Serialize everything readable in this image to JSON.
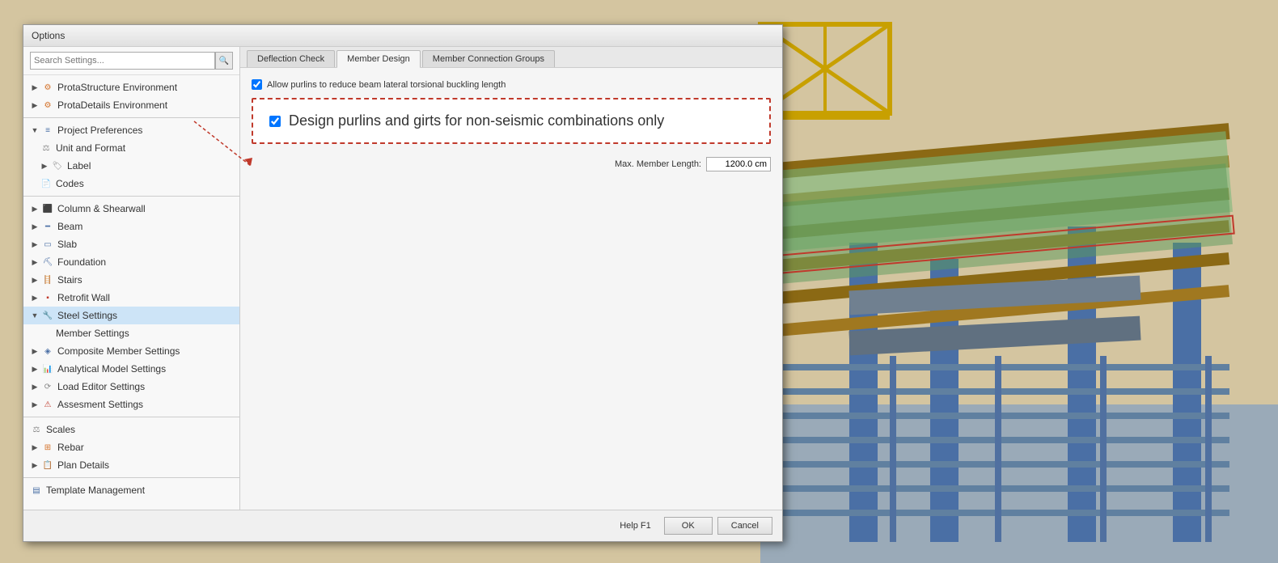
{
  "dialog": {
    "title": "Options",
    "search_placeholder": "Search Settings..."
  },
  "sidebar": {
    "items": [
      {
        "id": "prota-structure",
        "label": "ProtaStructure Environment",
        "level": 0,
        "icon": "orange-gear",
        "expanded": false,
        "selected": false
      },
      {
        "id": "prota-details",
        "label": "ProtaDetails Environment",
        "level": 0,
        "icon": "orange-gear",
        "expanded": false,
        "selected": false
      },
      {
        "id": "project-prefs",
        "label": "Project Preferences",
        "level": 0,
        "icon": "blue-list",
        "expanded": true,
        "selected": false
      },
      {
        "id": "unit-format",
        "label": "Unit and Format",
        "level": 1,
        "icon": "scales",
        "expanded": false,
        "selected": false
      },
      {
        "id": "label",
        "label": "Label",
        "level": 1,
        "icon": "tag",
        "expanded": false,
        "selected": false
      },
      {
        "id": "codes",
        "label": "Codes",
        "level": 1,
        "icon": "doc",
        "expanded": false,
        "selected": false
      },
      {
        "id": "column-shearwall",
        "label": "Column & Shearwall",
        "level": 0,
        "icon": "column",
        "expanded": false,
        "selected": false
      },
      {
        "id": "beam",
        "label": "Beam",
        "level": 0,
        "icon": "beam",
        "expanded": false,
        "selected": false
      },
      {
        "id": "slab",
        "label": "Slab",
        "level": 0,
        "icon": "slab",
        "expanded": false,
        "selected": false
      },
      {
        "id": "foundation",
        "label": "Foundation",
        "level": 0,
        "icon": "foundation",
        "expanded": false,
        "selected": false
      },
      {
        "id": "stairs",
        "label": "Stairs",
        "level": 0,
        "icon": "stairs",
        "expanded": false,
        "selected": false
      },
      {
        "id": "retrofit-wall",
        "label": "Retrofit Wall",
        "level": 0,
        "icon": "wall",
        "expanded": false,
        "selected": false
      },
      {
        "id": "steel-settings",
        "label": "Steel Settings",
        "level": 0,
        "icon": "steel",
        "expanded": true,
        "selected": true
      },
      {
        "id": "member-settings",
        "label": "Member Settings",
        "level": 1,
        "icon": "none",
        "expanded": false,
        "selected": false
      },
      {
        "id": "composite-member",
        "label": "Composite Member Settings",
        "level": 0,
        "icon": "composite",
        "expanded": false,
        "selected": false
      },
      {
        "id": "analytical-model",
        "label": "Analytical Model Settings",
        "level": 0,
        "icon": "analytical",
        "expanded": false,
        "selected": false
      },
      {
        "id": "load-editor",
        "label": "Load Editor Settings",
        "level": 0,
        "icon": "load",
        "expanded": false,
        "selected": false
      },
      {
        "id": "assessment",
        "label": "Assesment Settings",
        "level": 0,
        "icon": "assessment",
        "expanded": false,
        "selected": false
      },
      {
        "id": "scales",
        "label": "Scales",
        "level": 0,
        "icon": "scales2",
        "expanded": false,
        "selected": false
      },
      {
        "id": "rebar",
        "label": "Rebar",
        "level": 0,
        "icon": "rebar",
        "expanded": false,
        "selected": false
      },
      {
        "id": "plan-details",
        "label": "Plan Details",
        "level": 0,
        "icon": "plan",
        "expanded": false,
        "selected": false
      },
      {
        "id": "template-mgmt",
        "label": "Template Management",
        "level": 0,
        "icon": "template",
        "expanded": false,
        "selected": false
      }
    ]
  },
  "tabs": [
    {
      "id": "deflection-check",
      "label": "Deflection Check",
      "active": false
    },
    {
      "id": "member-design",
      "label": "Member Design",
      "active": true
    },
    {
      "id": "member-connection",
      "label": "Member Connection Groups",
      "active": false
    }
  ],
  "content": {
    "checkbox1_label": "Allow purlins to reduce beam lateral torsional buckling length",
    "checkbox1_checked": true,
    "highlight_checkbox_label": "Design purlins and girts for non-seismic combinations only",
    "highlight_checked": true,
    "max_member_length_label": "Max. Member Length:",
    "max_member_length_value": "1200.0 cm"
  },
  "footer": {
    "help_label": "Help  F1",
    "ok_label": "OK",
    "cancel_label": "Cancel"
  }
}
